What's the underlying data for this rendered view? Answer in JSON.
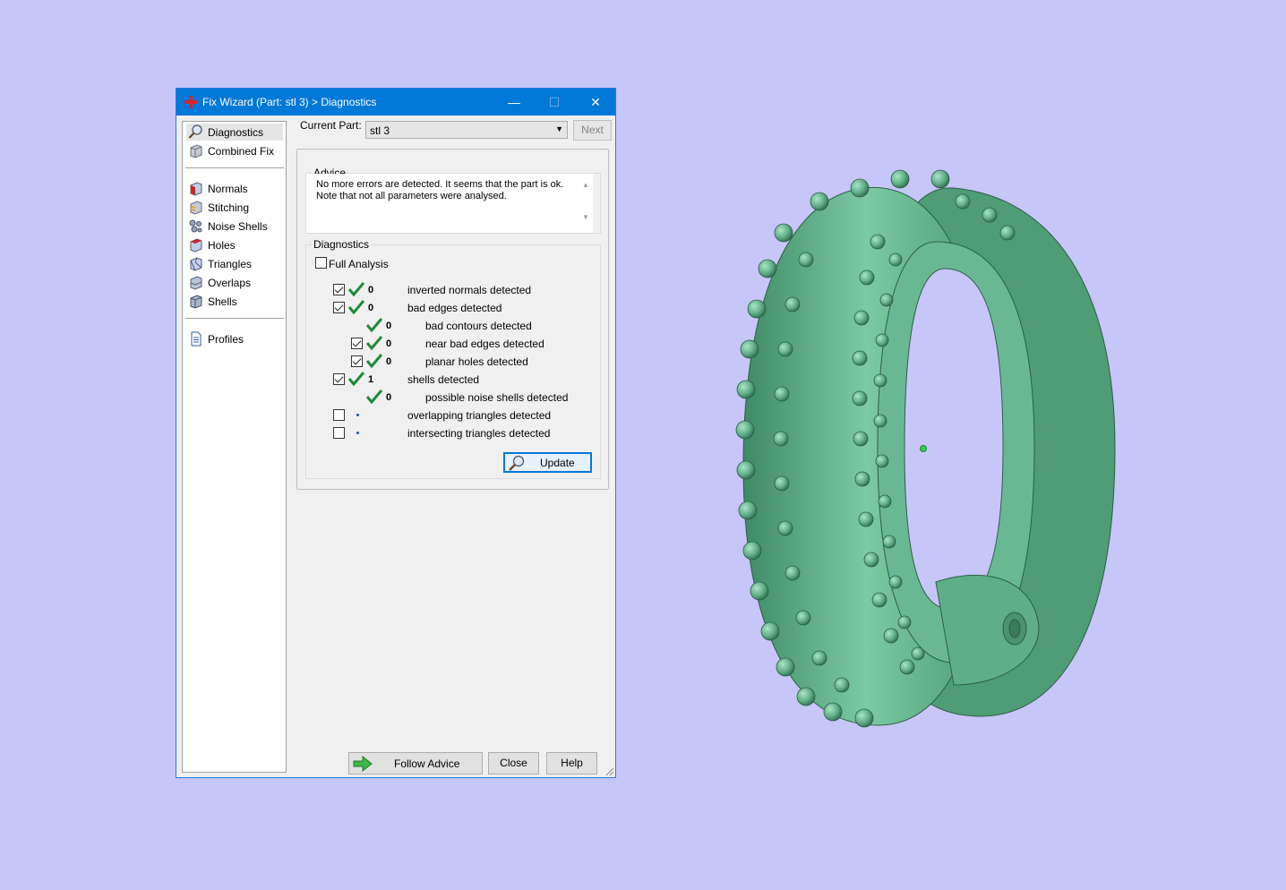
{
  "window": {
    "title": "Fix Wizard (Part: stl 3) > Diagnostics",
    "minimize_glyph": "—",
    "maximize_glyph": "☐",
    "close_glyph": "✕"
  },
  "sidebar": {
    "items": [
      {
        "label": "Diagnostics",
        "icon": "magnifier-icon"
      },
      {
        "label": "Combined Fix",
        "icon": "cube-icon"
      },
      {
        "label": "Normals",
        "icon": "normals-cube-icon"
      },
      {
        "label": "Stitching",
        "icon": "stitching-icon"
      },
      {
        "label": "Noise Shells",
        "icon": "noise-shells-icon"
      },
      {
        "label": "Holes",
        "icon": "holes-icon"
      },
      {
        "label": "Triangles",
        "icon": "triangles-icon"
      },
      {
        "label": "Overlaps",
        "icon": "overlaps-icon"
      },
      {
        "label": "Shells",
        "icon": "shells-icon"
      },
      {
        "label": "Profiles",
        "icon": "document-icon"
      }
    ]
  },
  "current_part": {
    "label": "Current Part:",
    "value": "stl 3",
    "next_label": "Next"
  },
  "advice": {
    "title": "Advice",
    "line1": "No more errors are detected. It seems that the part is ok.",
    "line2": "Note that not all parameters were analysed."
  },
  "diagnostics": {
    "title": "Diagnostics",
    "full_analysis_label": "Full Analysis",
    "rows": [
      {
        "count": "0",
        "label": "inverted normals detected"
      },
      {
        "count": "0",
        "label": "bad edges detected"
      },
      {
        "count": "0",
        "label": "bad contours detected"
      },
      {
        "count": "0",
        "label": "near bad edges detected"
      },
      {
        "count": "0",
        "label": "planar holes detected"
      },
      {
        "count": "1",
        "label": "shells detected"
      },
      {
        "count": "0",
        "label": "possible noise shells detected"
      },
      {
        "count": "",
        "label": "overlapping triangles detected"
      },
      {
        "count": "",
        "label": "intersecting triangles detected"
      }
    ],
    "update_label": "Update"
  },
  "footer": {
    "follow_advice_label": "Follow Advice",
    "close_label": "Close",
    "help_label": "Help"
  },
  "colors": {
    "background": "#c7c6f9",
    "titlebar": "#0078d7",
    "model_green": "#5fae87",
    "check_green": "#1f8a3a"
  }
}
